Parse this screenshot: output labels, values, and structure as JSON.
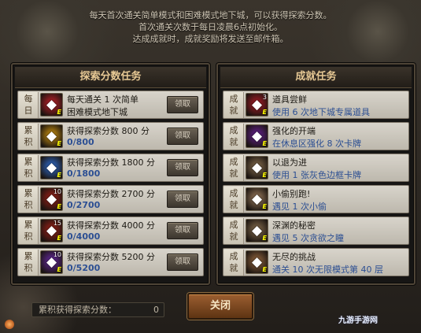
{
  "notice": [
    "每天首次通关简单模式和困难模式地下城，可以获得探索分数。",
    "首次通关次数于每日凌晨6点初始化。",
    "达成成就时，成就奖励将发送至邮件箱。"
  ],
  "explore": {
    "title": "探索分数任务",
    "rows": [
      {
        "cat": "每日",
        "level": "",
        "icon": "dungeon-axe-icon",
        "color": "#c8202a",
        "line1": "每天通关 1 次简单",
        "line2": "困难模式地下城",
        "button": "领取"
      },
      {
        "cat": "累积",
        "level": "",
        "icon": "gold-armor-icon",
        "color": "#d69a10",
        "line1": "获得探索分数 800 分",
        "line2": "0/800",
        "button": "领取"
      },
      {
        "cat": "累积",
        "level": "",
        "icon": "blue-armor-icon",
        "color": "#2f70d8",
        "line1": "获得探索分数 1800 分",
        "line2": "0/1800",
        "button": "领取"
      },
      {
        "cat": "累积",
        "level": "10",
        "icon": "red-scroll-icon",
        "color": "#a02018",
        "line1": "获得探索分数 2700 分",
        "line2": "0/2700",
        "button": "领取"
      },
      {
        "cat": "累积",
        "level": "15",
        "icon": "red-scroll-icon",
        "color": "#a02018",
        "line1": "获得探索分数 4000 分",
        "line2": "0/4000",
        "button": "领取"
      },
      {
        "cat": "累积",
        "level": "10",
        "icon": "purple-scroll-icon",
        "color": "#6a2aa8",
        "line1": "获得探索分数 5200 分",
        "line2": "0/5200",
        "button": "领取"
      }
    ]
  },
  "achievement": {
    "title": "成就任务",
    "rows": [
      {
        "cat": "成就",
        "level": "3",
        "icon": "red-box-icon",
        "color": "#b01c28",
        "line1": "道具尝鲜",
        "line2": "使用 6 次地下城专属道具"
      },
      {
        "cat": "成就",
        "level": "",
        "icon": "purple-orb-icon",
        "color": "#6a2098",
        "line1": "强化的开端",
        "line2": "在休息区强化 8 次卡牌"
      },
      {
        "cat": "成就",
        "level": "",
        "icon": "scroll-card-icon",
        "color": "#8a7050",
        "line1": "以退为进",
        "line2": "使用 1 张灰色边框卡牌"
      },
      {
        "cat": "成就",
        "level": "",
        "icon": "scroll-card-icon",
        "color": "#a08060",
        "line1": "小偷别跑!",
        "line2": "遇见 1 次小偷"
      },
      {
        "cat": "成就",
        "level": "",
        "icon": "scroll-card-icon",
        "color": "#8a7050",
        "line1": "深渊的秘密",
        "line2": "遇见 5 次贪欲之瞳"
      },
      {
        "cat": "成就",
        "level": "",
        "icon": "scroll-card-icon",
        "color": "#9a6a40",
        "line1": "无尽的挑战",
        "line2": "通关 10 次无限模式第 40 层"
      }
    ]
  },
  "footer": {
    "score_label": "累积获得探索分数：",
    "score_value": "0",
    "close_label": "关闭",
    "watermark": "九游手游网"
  }
}
